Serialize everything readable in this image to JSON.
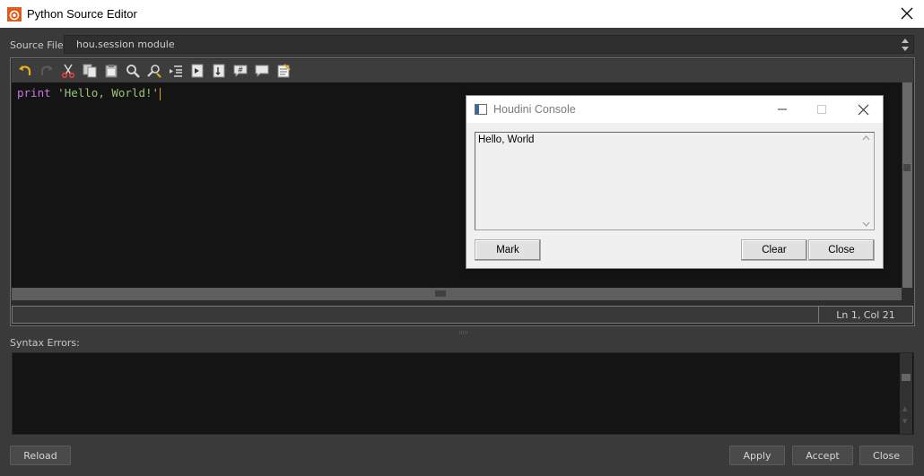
{
  "window": {
    "title": "Python Source Editor"
  },
  "source": {
    "label": "Source File:",
    "value": "hou.session module"
  },
  "toolbar": {
    "icons": [
      "undo-icon",
      "redo-icon",
      "cut-icon",
      "copy-icon",
      "paste-icon",
      "find-icon",
      "replace-icon",
      "indent-icon",
      "goto-icon",
      "bookmark-icon",
      "comment-icon",
      "uncomment-icon",
      "notes-icon"
    ]
  },
  "editor": {
    "code_keyword": "print",
    "code_string": "'Hello, World!'"
  },
  "status": {
    "position": "Ln 1, Col 21"
  },
  "syntax": {
    "label": "Syntax Errors:"
  },
  "buttons": {
    "reload": "Reload",
    "apply": "Apply",
    "accept": "Accept",
    "close": "Close"
  },
  "console": {
    "title": "Houdini Console",
    "output": "Hello, World",
    "mark": "Mark",
    "clear": "Clear",
    "close": "Close"
  },
  "colors": {
    "accent": "#e05a1a",
    "keyword": "#c678dd",
    "string": "#98c379"
  }
}
